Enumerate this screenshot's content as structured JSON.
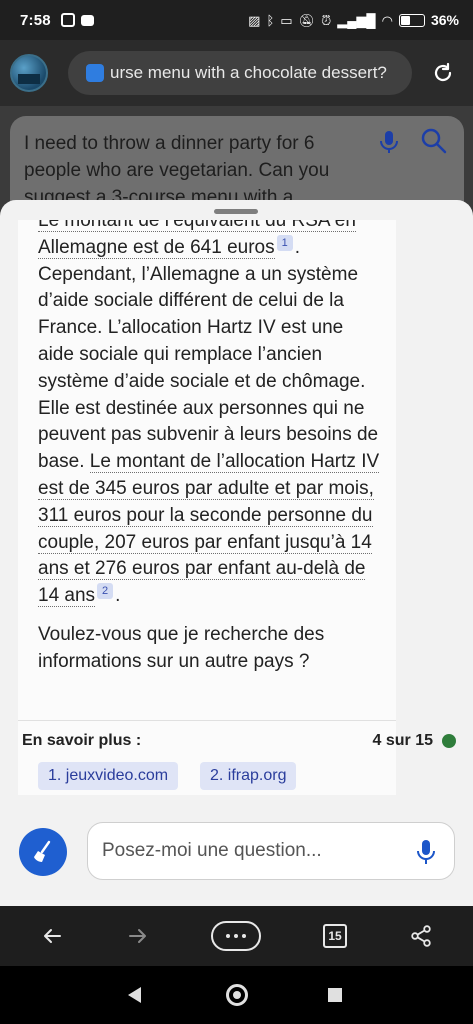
{
  "status": {
    "time": "7:58",
    "battery_pct": "36",
    "battery_level": 0.36
  },
  "browser": {
    "url_text": "urse menu with a chocolate dessert?"
  },
  "query": {
    "text": "I need to throw a dinner party for 6 people who are vegetarian. Can you suggest a 3-course menu with a"
  },
  "answer": {
    "line_top": "Le montant de l’équivalent du RSA en",
    "seg1": "Allemagne est de 641 euros",
    "cite1": "1",
    "seg2": ". Cependant, l’Allemagne a un système d’aide sociale différent de celui de la France. L’allocation Hartz IV est une aide sociale qui remplace l’ancien système d’aide sociale et de chômage. Elle est destinée aux personnes qui ne peuvent pas subvenir à leurs besoins de base.",
    "seg3": "Le montant de l’allocation Hartz IV est de 345 euros par adulte et par mois, 311 euros pour la seconde personne du couple, 207 euros par enfant jusqu’à 14 ans et 276 euros par enfant au-delà de 14 ans",
    "cite2": "2",
    "seg4": ".",
    "followup": "Voulez-vous que je recherche des informations sur un autre pays ?"
  },
  "learn_more": {
    "title": "En savoir plus :",
    "count": "4 sur 15",
    "sources": [
      "1. jeuxvideo.com",
      "2. ifrap.org"
    ]
  },
  "input": {
    "placeholder": "Posez-moi une question..."
  },
  "toolbar": {
    "tab_count": "15"
  },
  "icons": [
    "photo-icon",
    "youtube-icon",
    "sim-icon",
    "bluetooth-icon",
    "mute-icon",
    "alarm-icon",
    "signal-icon",
    "wifi-icon",
    "battery-icon",
    "avatar",
    "lock-icon",
    "refresh-icon",
    "mic-icon",
    "search-icon",
    "broom-icon",
    "back-arrow-icon",
    "forward-arrow-icon",
    "more-icon",
    "tabs-icon",
    "share-icon"
  ],
  "colors": {
    "accent": "#1f5fd0",
    "citation_bg": "#d4dcf3",
    "source_chip_bg": "#dfe4f6",
    "status_dot": "#2f7d3b"
  }
}
